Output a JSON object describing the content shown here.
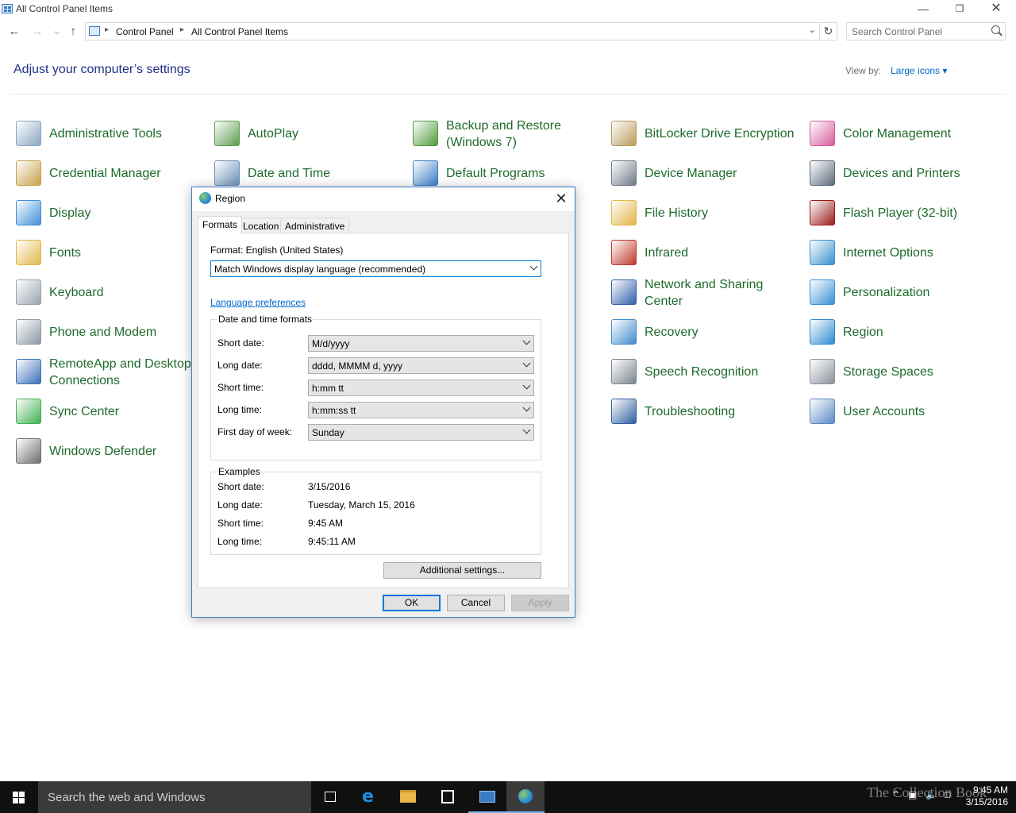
{
  "window": {
    "title": "All Control Panel Items"
  },
  "address": {
    "crumbs": [
      "Control Panel",
      "All Control Panel Items"
    ],
    "search_placeholder": "Search Control Panel"
  },
  "header": {
    "heading": "Adjust your computer’s settings",
    "view_by_label": "View by:",
    "view_by_value": "Large icons ▾"
  },
  "items": [
    {
      "label": "Administrative Tools"
    },
    {
      "label": "AutoPlay"
    },
    {
      "label": "Backup and Restore\n(Windows 7)"
    },
    {
      "label": "BitLocker Drive Encryption"
    },
    {
      "label": "Color Management"
    },
    {
      "label": "Credential Manager"
    },
    {
      "label": "Date and Time"
    },
    {
      "label": "Default Programs"
    },
    {
      "label": "Device Manager"
    },
    {
      "label": "Devices and Printers"
    },
    {
      "label": "Display"
    },
    {
      "label": "File History"
    },
    {
      "label": "Flash Player (32-bit)"
    },
    {
      "label": "Fonts"
    },
    {
      "label": "Infrared"
    },
    {
      "label": "Internet Options"
    },
    {
      "label": "Keyboard"
    },
    {
      "label": "Network and Sharing\nCenter"
    },
    {
      "label": "Personalization"
    },
    {
      "label": "Phone and Modem"
    },
    {
      "label": "Recovery"
    },
    {
      "label": "Region"
    },
    {
      "label": "RemoteApp and Desktop\nConnections"
    },
    {
      "label": "Speech Recognition"
    },
    {
      "label": "Storage Spaces"
    },
    {
      "label": "Sync Center"
    },
    {
      "label": "Troubleshooting"
    },
    {
      "label": "User Accounts"
    },
    {
      "label": "Windows Defender"
    }
  ],
  "dialog": {
    "title": "Region",
    "tabs": [
      "Formats",
      "Location",
      "Administrative"
    ],
    "format_label": "Format: English (United States)",
    "format_value": "Match Windows display language (recommended)",
    "language_link": "Language preferences",
    "dt_group": "Date and time formats",
    "fields": [
      {
        "label": "Short date:",
        "value": "M/d/yyyy"
      },
      {
        "label": "Long date:",
        "value": "dddd, MMMM d, yyyy"
      },
      {
        "label": "Short time:",
        "value": "h:mm tt"
      },
      {
        "label": "Long time:",
        "value": "h:mm:ss tt"
      },
      {
        "label": "First day of week:",
        "value": "Sunday"
      }
    ],
    "examples_group": "Examples",
    "examples": [
      {
        "label": "Short date:",
        "value": "3/15/2016"
      },
      {
        "label": "Long date:",
        "value": "Tuesday, March 15, 2016"
      },
      {
        "label": "Short time:",
        "value": "9:45 AM"
      },
      {
        "label": "Long time:",
        "value": "9:45:11 AM"
      }
    ],
    "additional_button": "Additional settings...",
    "ok_button": "OK",
    "cancel_button": "Cancel",
    "apply_button": "Apply"
  },
  "taskbar": {
    "search_placeholder": "Search the web and Windows",
    "clock_time": "9:45 AM",
    "clock_date": "3/15/2016",
    "watermark": "The Collection Book"
  },
  "colors": {
    "heading": "#1e3287",
    "item_label": "#1e6b2b",
    "link": "#0066cc",
    "accent": "#0078d7",
    "taskbar": "#101010"
  }
}
